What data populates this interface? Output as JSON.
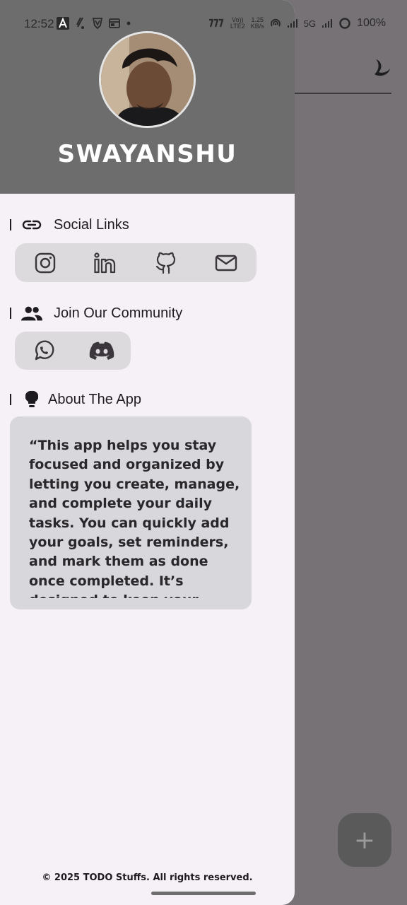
{
  "status_bar": {
    "time": "12:52",
    "net_speed_top": "1.25",
    "net_speed_bottom": "KB/s",
    "volte_top": "Vo))",
    "volte_bottom": "LTE2",
    "network_label": "5G",
    "battery": "100%"
  },
  "drawer": {
    "user_name": "SWAYANSHU",
    "social": {
      "title": "Social Links",
      "icons": [
        "instagram-icon",
        "linkedin-icon",
        "github-icon",
        "mail-icon"
      ]
    },
    "community": {
      "title": "Join Our Community",
      "icons": [
        "whatsapp-icon",
        "discord-icon"
      ]
    },
    "about": {
      "title": "About The App",
      "text": "“This app helps you stay focused and organized by letting you create, manage, and complete your daily tasks. You can quickly add your goals, set reminders, and mark them as done once completed. It’s designed to keep your"
    },
    "footer": "© 2025 TODO Stuffs. All rights reserved."
  },
  "background": {
    "fab_label": "+",
    "theme_icon": "moon-icon"
  },
  "colors": {
    "header": "#6c6d6c",
    "drawer_bg": "#f6f1f7",
    "pill_bg": "#dcdadd",
    "scrim": "#767275"
  }
}
